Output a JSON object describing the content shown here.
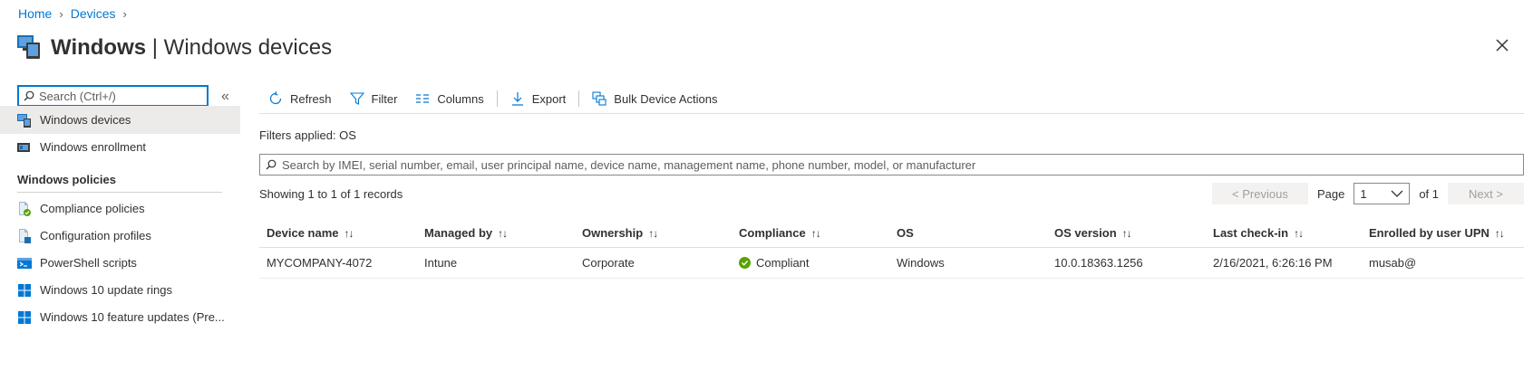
{
  "breadcrumb": {
    "home": "Home",
    "devices": "Devices"
  },
  "header": {
    "title_bold": "Windows",
    "title_rest": " | Windows devices",
    "icon": "windows-devices-icon"
  },
  "sidebar": {
    "search_placeholder": "Search (Ctrl+/)",
    "items": [
      {
        "label": "Windows devices",
        "icon": "windows-devices-icon",
        "active": true
      },
      {
        "label": "Windows enrollment",
        "icon": "enrollment-icon"
      }
    ],
    "section_title": "Windows policies",
    "policy_items": [
      {
        "label": "Compliance policies",
        "icon": "compliance-policy-icon"
      },
      {
        "label": "Configuration profiles",
        "icon": "configuration-profile-icon"
      },
      {
        "label": "PowerShell scripts",
        "icon": "powershell-icon"
      },
      {
        "label": "Windows 10 update rings",
        "icon": "windows-logo-icon"
      },
      {
        "label": "Windows 10 feature updates (Pre...",
        "icon": "windows-logo-icon"
      }
    ]
  },
  "toolbar": {
    "refresh": "Refresh",
    "filter": "Filter",
    "columns": "Columns",
    "export": "Export",
    "bulk": "Bulk Device Actions"
  },
  "filters_applied": "Filters applied: OS",
  "search_placeholder": "Search by IMEI, serial number, email, user principal name, device name, management name, phone number, model, or manufacturer",
  "records_text": "Showing 1 to 1 of 1 records",
  "pager": {
    "previous": "< Previous",
    "page_label": "Page",
    "page_value": "1",
    "of_label": "of 1",
    "next": "Next >"
  },
  "table": {
    "columns": [
      "Device name",
      "Managed by",
      "Ownership",
      "Compliance",
      "OS",
      "OS version",
      "Last check-in",
      "Enrolled by user UPN"
    ],
    "rows": [
      [
        "MYCOMPANY-4072",
        "Intune",
        "Corporate",
        "Compliant",
        "Windows",
        "10.0.18363.1256",
        "2/16/2021, 6:26:16 PM",
        "musab@"
      ]
    ]
  },
  "colors": {
    "accent": "#0078d4",
    "success": "#57a300",
    "active_bg": "#edebe9"
  }
}
